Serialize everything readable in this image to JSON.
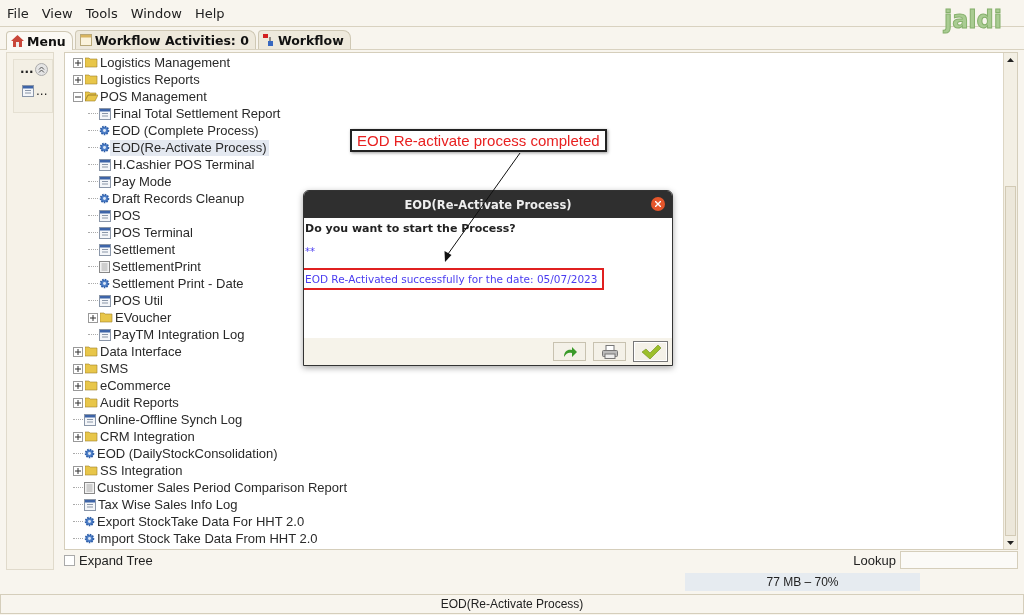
{
  "window": {
    "logo": "jaldi"
  },
  "menu_bar": [
    "File",
    "View",
    "Tools",
    "Window",
    "Help"
  ],
  "tabs": [
    {
      "label": "Menu",
      "kind": "home",
      "selected": true
    },
    {
      "label": "Workflow Activities: 0",
      "kind": "window",
      "selected": false
    },
    {
      "label": "Workflow",
      "kind": "diagram",
      "selected": false
    }
  ],
  "side_panel": {
    "header": "...",
    "items": [
      {
        "label": "..."
      }
    ]
  },
  "tree": [
    {
      "label": "Logistics Management",
      "kind": "folder",
      "expanded": false,
      "selected": false
    },
    {
      "label": "Logistics Reports",
      "kind": "folder",
      "expanded": false,
      "selected": false
    },
    {
      "label": "POS Management",
      "kind": "folder",
      "expanded": true,
      "selected": false,
      "children": [
        {
          "label": "Final Total Settlement Report",
          "kind": "form",
          "selected": false
        },
        {
          "label": "EOD (Complete Process)",
          "kind": "process",
          "selected": false
        },
        {
          "label": "EOD(Re-Activate Process)",
          "kind": "process",
          "selected": true
        },
        {
          "label": "H.Cashier POS Terminal",
          "kind": "form",
          "selected": false
        },
        {
          "label": "Pay Mode",
          "kind": "form",
          "selected": false
        },
        {
          "label": "Draft Records Cleanup",
          "kind": "process",
          "selected": false
        },
        {
          "label": "POS",
          "kind": "form",
          "selected": false
        },
        {
          "label": "POS Terminal",
          "kind": "form",
          "selected": false
        },
        {
          "label": "Settlement",
          "kind": "form",
          "selected": false
        },
        {
          "label": "SettlementPrint",
          "kind": "document",
          "selected": false
        },
        {
          "label": "Settlement Print - Date",
          "kind": "process",
          "selected": false
        },
        {
          "label": "POS Util",
          "kind": "form",
          "selected": false
        },
        {
          "label": "EVoucher",
          "kind": "folder",
          "expanded": false,
          "selected": false
        },
        {
          "label": "PayTM Integration Log",
          "kind": "form",
          "selected": false
        }
      ]
    },
    {
      "label": "Data Interface",
      "kind": "folder",
      "expanded": false,
      "selected": false
    },
    {
      "label": "SMS",
      "kind": "folder",
      "expanded": false,
      "selected": false
    },
    {
      "label": "eCommerce",
      "kind": "folder",
      "expanded": false,
      "selected": false
    },
    {
      "label": "Audit Reports",
      "kind": "folder",
      "expanded": false,
      "selected": false
    },
    {
      "label": "Online-Offline Synch Log",
      "kind": "form",
      "selected": false
    },
    {
      "label": "CRM Integration",
      "kind": "folder",
      "expanded": false,
      "selected": false
    },
    {
      "label": "EOD (DailyStockConsolidation)",
      "kind": "process",
      "selected": false
    },
    {
      "label": "SS Integration",
      "kind": "folder",
      "expanded": false,
      "selected": false
    },
    {
      "label": "Customer Sales Period Comparison Report",
      "kind": "document",
      "selected": false
    },
    {
      "label": "Tax Wise Sales Info Log",
      "kind": "form",
      "selected": false
    },
    {
      "label": "Export StockTake Data For HHT 2.0",
      "kind": "process",
      "selected": false
    },
    {
      "label": "Import Stock Take Data From HHT 2.0",
      "kind": "process",
      "selected": false
    }
  ],
  "tree_footer": {
    "expand_tree": {
      "label": "Expand Tree",
      "checked": false
    },
    "lookup": {
      "label": "Lookup"
    }
  },
  "memory": {
    "text": "77 MB – 70%"
  },
  "status_bar": "EOD(Re-Activate Process)",
  "dialog": {
    "title": "EOD(Re-Activate Process)",
    "question": "Do you want to start the Process?",
    "marker": "**",
    "message": "EOD Re-Activated successfully for the date: 05/07/2023",
    "highlighted": true,
    "buttons": [
      {
        "kind": "redo",
        "focused": false
      },
      {
        "kind": "print",
        "focused": false
      },
      {
        "kind": "ok",
        "focused": true
      }
    ]
  },
  "annotation": {
    "text": "EOD Re-activate process completed"
  }
}
